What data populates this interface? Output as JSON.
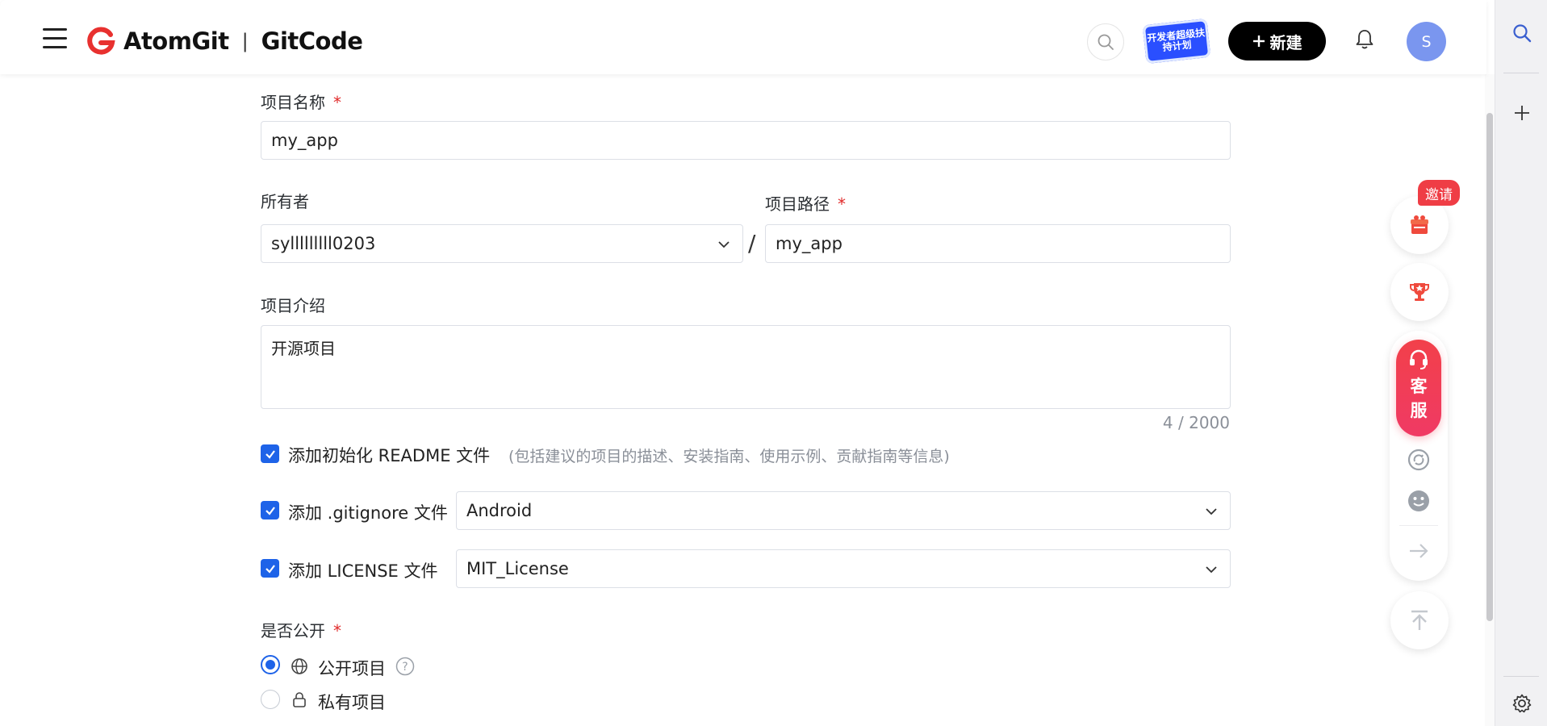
{
  "header": {
    "brand_primary": "AtomGit",
    "brand_secondary": "GitCode",
    "dev_badge": "开发者超级扶持计划",
    "new_label": "新建",
    "avatar_initial": "S"
  },
  "form": {
    "name_label": "项目名称",
    "name_value": "my_app",
    "owner_label": "所有者",
    "owner_value": "sylllllllll0203",
    "path_separator": "/",
    "path_label": "项目路径",
    "path_value": "my_app",
    "desc_label": "项目介绍",
    "desc_value": "开源项目",
    "desc_counter": "4 / 2000",
    "readme_label": "添加初始化 README 文件",
    "readme_hint": "(包括建议的项目的描述、安装指南、使用示例、贡献指南等信息)",
    "readme_checked": true,
    "gitignore_label": "添加 .gitignore 文件",
    "gitignore_value": "Android",
    "gitignore_checked": true,
    "license_label": "添加 LICENSE 文件",
    "license_value": "MIT_License",
    "license_checked": true,
    "visibility_label": "是否公开",
    "visibility_options": [
      {
        "label": "公开项目",
        "selected": true
      },
      {
        "label": "私有项目",
        "selected": false
      }
    ],
    "required_mark": "*"
  },
  "floating": {
    "invite_label": "邀请",
    "service_label_1": "客",
    "service_label_2": "服"
  },
  "colors": {
    "accent": "#1e63e8",
    "brand_red": "#e8312f",
    "service_red": "#f2404a"
  }
}
